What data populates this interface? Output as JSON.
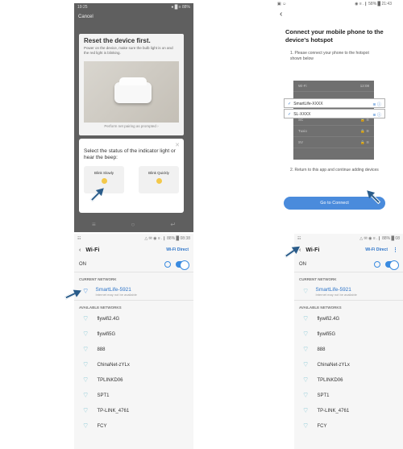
{
  "panel1": {
    "status_left": "19:25",
    "status_right": "● █ ≡ 88%",
    "cancel": "Cancel",
    "title": "Reset the device first.",
    "description": "Power on the device, make sure the bulb light is on and the red light is blinking.",
    "pair_hint": "Perform net pairing as prompted ›",
    "sheet_question": "Select the status of the indicator light or hear the beep:",
    "option_slow": "Blink Slowly",
    "option_quick": "Blink Quickly",
    "nav_icons": [
      "≡",
      "○",
      "↵"
    ]
  },
  "panel2": {
    "status_left": "▣ ☺",
    "status_right": "◉ ≡ .❙ 58% █ 21:43",
    "title": "Connect your mobile phone to the device's hotspot",
    "step1": "1. Please connect your phone to the hotspot shown below",
    "mock_header": "Wi-Fi",
    "mock_time": "12:08",
    "networks_highlight": [
      "SmartLife-XXXX",
      "SL-XXXX"
    ],
    "networks_dim": [
      "SC",
      "Tuxio",
      "SV"
    ],
    "step2": "2. Return to this app and continue adding devices",
    "button": "Go to Connect"
  },
  "panel3": {
    "status_left": "☷",
    "status_right": "△ ✉ ◉ ≡ .❙ 88% █ 08:38",
    "title": "Wi-Fi",
    "wifi_direct": "Wi-Fi Direct",
    "on_label": "ON",
    "current_header": "CURRENT NETWORK",
    "current_name": "SmartLife-5921",
    "current_sub": "Internet may not be available",
    "available_header": "AVAILABLE NETWORKS",
    "networks": [
      "flywifi2.4G",
      "flywifi5G",
      "888",
      "ChinaNet-zYLx",
      "TPLINKD06",
      "SPT1",
      "TP-LINK_4761",
      "FCY"
    ]
  },
  "panel4": {
    "status_left": "☷",
    "status_right": "△ ✉ ◉ ≡ .❙ 88% █ 08",
    "title": "Wi-Fi",
    "wifi_direct": "Wi-Fi Direct",
    "on_label": "ON",
    "current_header": "CURRENT NETWORK",
    "current_name": "SmartLife-5921",
    "current_sub": "Internet may not be available",
    "available_header": "AVAILABLE NETWORKS",
    "networks": [
      "flywifi2.4G",
      "flywifi5G",
      "888",
      "ChinaNet-zYLx",
      "TPLINKD06",
      "SPT1",
      "TP-LINK_4761",
      "FCY"
    ]
  },
  "colors": {
    "accent": "#2b73c8",
    "button": "#4a8bdc",
    "arrow": "#2a5c8a"
  }
}
